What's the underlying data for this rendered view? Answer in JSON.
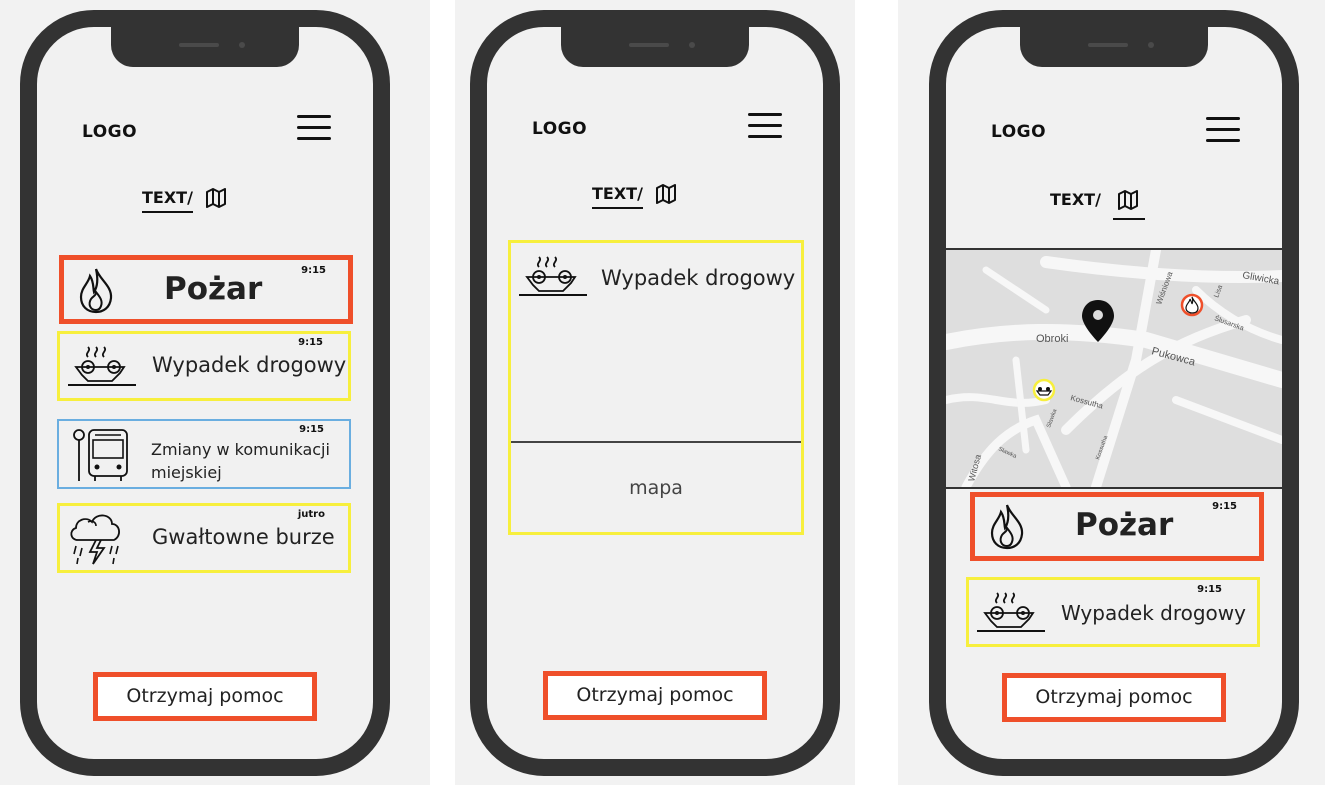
{
  "colors": {
    "fire": "#ef4f2a",
    "warning": "#f7ef3d",
    "info": "#6aaee0",
    "frame": "#333333",
    "screen": "#f1f1f1"
  },
  "common": {
    "logo": "LOGO",
    "text_tab": "TEXT/",
    "map_icon": "map-icon",
    "menu_icon": "hamburger-menu-icon",
    "help_button": "Otrzymaj pomoc"
  },
  "screen1": {
    "alerts": [
      {
        "icon": "fire-icon",
        "title": "Pożar",
        "time": "9:15"
      },
      {
        "icon": "car-accident-icon",
        "title": "Wypadek drogowy",
        "time": "9:15"
      },
      {
        "icon": "tram-stop-icon",
        "title_line1": "Zmiany w komunikacji",
        "title_line2": "miejskiej",
        "time": "9:15"
      },
      {
        "icon": "storm-icon",
        "title": "Gwałtowne burze",
        "time": "jutro"
      }
    ]
  },
  "screen2": {
    "detail": {
      "icon": "car-accident-icon",
      "title": "Wypadek drogowy",
      "map_placeholder": "mapa"
    }
  },
  "screen3": {
    "map": {
      "streets": [
        "Obroki",
        "Pukowca",
        "Kossutha",
        "Wiśniowa",
        "Gliwicka",
        "Lisa",
        "Ślusarska",
        "Witosa",
        "Sławka",
        "Sławka",
        "Kossutha"
      ]
    },
    "alerts": [
      {
        "icon": "fire-icon",
        "title": "Pożar",
        "time": "9:15"
      },
      {
        "icon": "car-accident-icon",
        "title": "Wypadek drogowy",
        "time": "9:15"
      }
    ]
  }
}
